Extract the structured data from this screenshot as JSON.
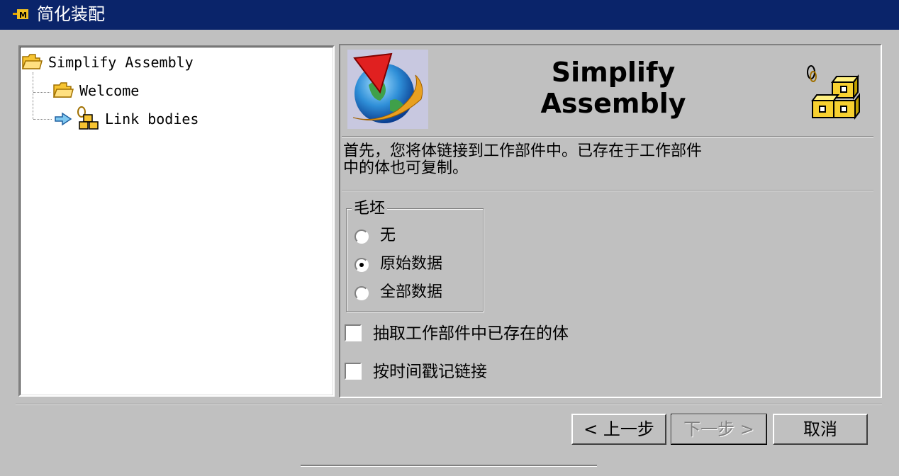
{
  "window": {
    "title": "简化装配",
    "title_icon": "nx-app-icon"
  },
  "tree": {
    "root": {
      "label": "Simplify Assembly",
      "icon": "folder-open-icon"
    },
    "children": [
      {
        "label": "Welcome",
        "icon": "folder-open-icon"
      },
      {
        "label": "Link bodies",
        "icon": "link-bodies-icon",
        "current_marker": "arrow-right-icon"
      }
    ]
  },
  "header": {
    "title_line1": "Simplify",
    "title_line2": "Assembly",
    "logo": "nx-globe-logo",
    "side_icon": "assembly-blocks-icon"
  },
  "description": {
    "line1": "首先，您将体链接到工作部件中。已存在于工作部件",
    "line2": "中的体也可复制。"
  },
  "stock_group": {
    "title": "毛坯",
    "options": [
      {
        "label": "无",
        "selected": false
      },
      {
        "label": "原始数据",
        "selected": true
      },
      {
        "label": "全部数据",
        "selected": false
      }
    ]
  },
  "checkboxes": [
    {
      "label": "抽取工作部件中已存在的体",
      "checked": false
    },
    {
      "label": "按时间戳记链接",
      "checked": false
    }
  ],
  "buttons": {
    "back": "< 上一步",
    "next": "下一步 >",
    "cancel": "取消",
    "next_disabled": true
  },
  "colors": {
    "titlebar": "#0a246a",
    "face": "#c0c0c0",
    "folder": "#f7c431"
  }
}
